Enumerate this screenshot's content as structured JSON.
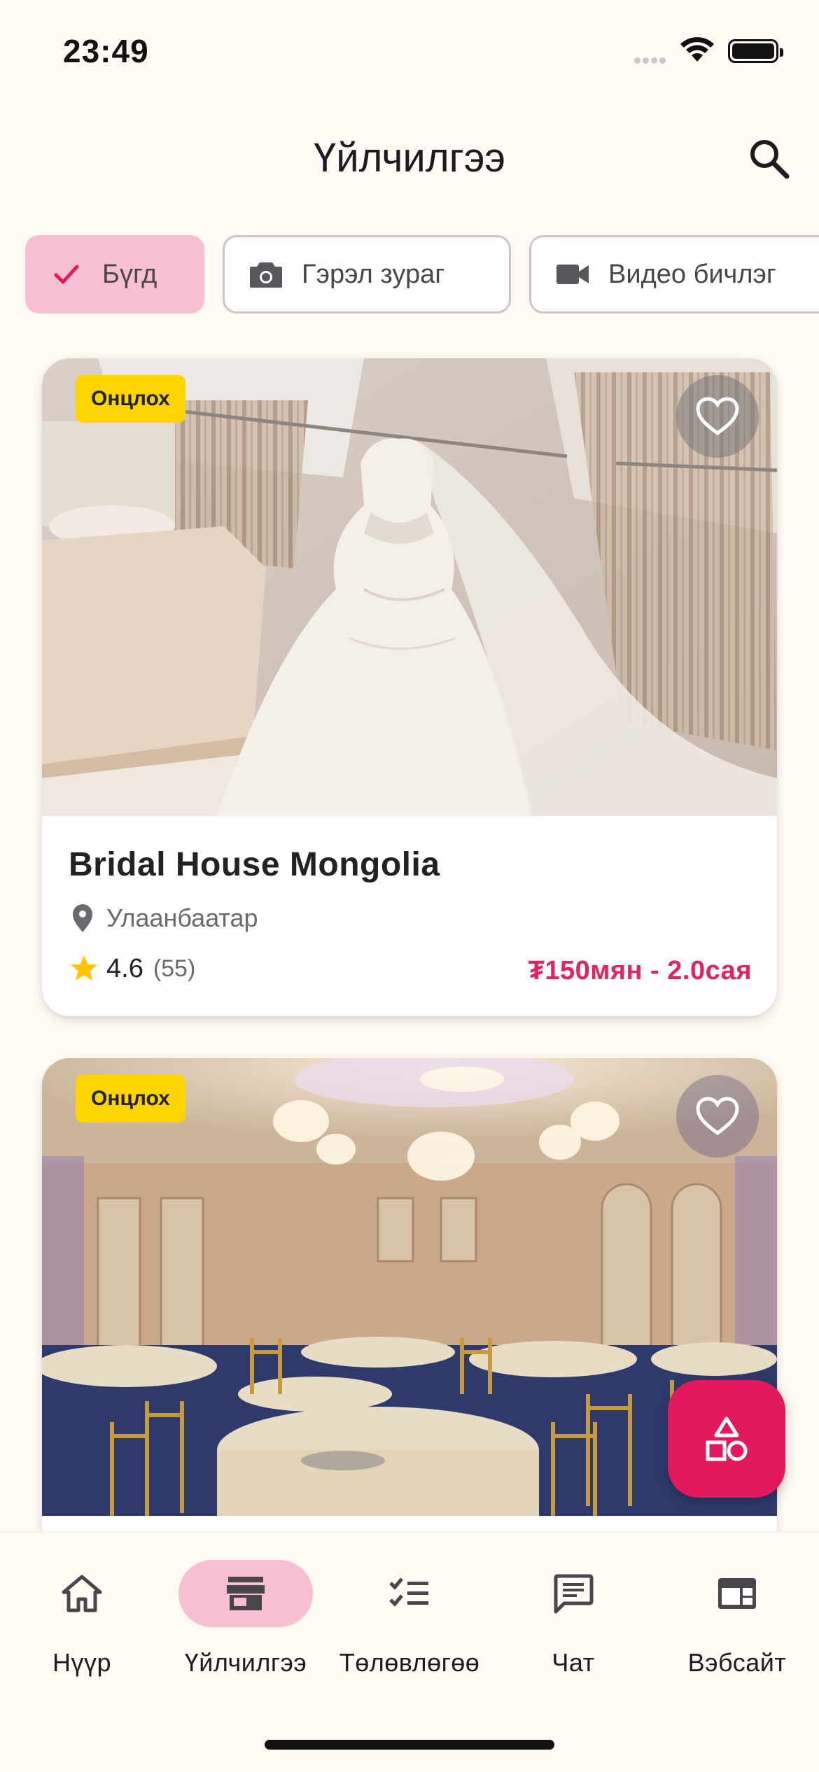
{
  "status_bar": {
    "time": "23:49"
  },
  "app_bar": {
    "title": "Үйлчилгээ",
    "action_icon": "search-icon"
  },
  "filters": [
    {
      "label": "Бүгд",
      "icon": "check-icon",
      "selected": true
    },
    {
      "label": "Гэрэл зураг",
      "icon": "camera-icon",
      "selected": false
    },
    {
      "label": "Видео бичлэг",
      "icon": "video-camera-icon",
      "selected": false
    }
  ],
  "cards": [
    {
      "badge": "Онцлох",
      "name": "Bridal House Mongolia",
      "location": "Улаанбаатар",
      "rating": "4.6",
      "reviews": "(55)",
      "price": "₮150мян - 2.0сая",
      "favorite": false
    },
    {
      "badge": "Онцлох",
      "favorite": false
    }
  ],
  "fab": {
    "icon": "shapes-icon"
  },
  "bottom_nav": [
    {
      "label": "Нүүр",
      "icon": "home-icon",
      "active": false
    },
    {
      "label": "Үйлчилгээ",
      "icon": "store-icon",
      "active": true
    },
    {
      "label": "Төлөвлөгөө",
      "icon": "checklist-icon",
      "active": false
    },
    {
      "label": "Чат",
      "icon": "chat-icon",
      "active": false
    },
    {
      "label": "Вэбсайт",
      "icon": "website-icon",
      "active": false
    }
  ],
  "colors": {
    "background": "#FFFAF3",
    "accent": "#E3195F",
    "selected_chip": "#F8BFD3",
    "badge": "#FFD400",
    "price": "#E0245E"
  }
}
